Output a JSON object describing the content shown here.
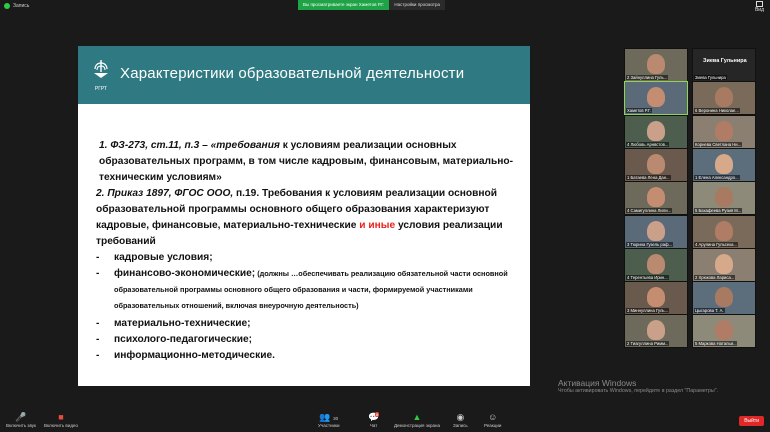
{
  "topbar": {
    "recording_label": "Запись",
    "banner_text": "Вы просматриваете экран Хаметов Р.Г.",
    "view_options_label": "Настройки просмотра",
    "view_button_label": "Вид"
  },
  "slide": {
    "logo_text": "РГРТ",
    "title": "Характеристики образовательной деятельности",
    "item1_prefix": "1. ФЗ-273, ст.11, п.3 – «",
    "item1_italic": "требования",
    "item1_rest": " к условиям реализации основных образовательных программ, в том числе кадровым, финансовым, материально-техническим условиям»",
    "item2_prefix": "2. Приказ 1897, ФГОС ООО,",
    "item2_rest": "  п.19. Требования к условиям реализации основной образовательной программы основного общего образования характеризуют кадровые, финансовые, материально-технические",
    "item2_red": " и иные",
    "item2_tail": " условия реализации требований",
    "list": [
      "кадровые условия;",
      "финансово-экономические;",
      "материально-технические;",
      "психолого-педагогические;",
      "информационно-методические."
    ],
    "finance_note": " (должны …обеспечивать реализацию обязательной части основной образовательной программы основного общего образования и части, формируемой участниками образовательных отношений, включая внеурочную деятельность)",
    "bullet": "-"
  },
  "windows_activation": {
    "line1": "Активация Windows",
    "line2": "Чтобы активировать Windows, перейдите в раздел \"Параметры\"."
  },
  "participants": [
    {
      "label": "2 Зайнуллина Гуль..."
    },
    {
      "label": "Зиева Гульнира",
      "big": "Зиева Гульнира"
    },
    {
      "label": "Хаметов Р.Г."
    },
    {
      "label": "6 Веронина Николае..."
    },
    {
      "label": "4 Любовь Арнвстов..."
    },
    {
      "label": "Корнева Светлана Ни..."
    },
    {
      "label": "1 Батаева Лена Дан..."
    },
    {
      "label": "1 Елена Александро..."
    },
    {
      "label": "4 Самигуллина Лили..."
    },
    {
      "label": "5 Бахафеева Рузия М..."
    },
    {
      "label": "3 Тюрина Гузель раф..."
    },
    {
      "label": "4 Арулина Гульсека..."
    },
    {
      "label": "4 Терентьева Ирин..."
    },
    {
      "label": "2 Хрюкова Лариса..."
    },
    {
      "label": "3 Миннуллина Гуль..."
    },
    {
      "label": "Цыгарова Т. А."
    },
    {
      "label": "2 Тиагуллина Римм..."
    },
    {
      "label": "5 Маркова Натальи..."
    }
  ],
  "toolbar": {
    "mic_label": "Включить звук",
    "video_label": "Включить видео",
    "participants_label": "Участники",
    "participants_count": "30",
    "chat_label": "Чат",
    "chat_badge": "8",
    "share_label": "Демонстрация экрана",
    "record_label": "Запись",
    "reactions_label": "Реакции",
    "exit_label": "Выйти"
  },
  "colors": {
    "slide_header": "#2f7a82",
    "accent_red": "#e8251c",
    "exit_red": "#e02828",
    "banner_green": "#1fa347"
  }
}
